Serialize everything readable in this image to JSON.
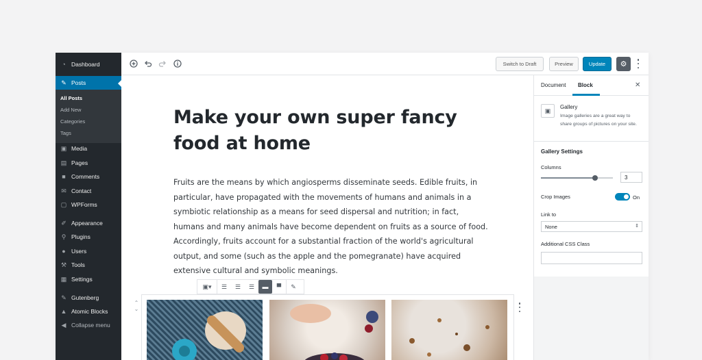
{
  "sidebar": {
    "items": [
      {
        "label": "Dashboard",
        "icon": "dashboard-icon"
      },
      {
        "label": "Posts",
        "icon": "pin-icon"
      },
      {
        "label": "Media",
        "icon": "media-icon"
      },
      {
        "label": "Pages",
        "icon": "pages-icon"
      },
      {
        "label": "Comments",
        "icon": "comment-icon"
      },
      {
        "label": "Contact",
        "icon": "mail-icon"
      },
      {
        "label": "WPForms",
        "icon": "forms-icon"
      },
      {
        "label": "Appearance",
        "icon": "brush-icon"
      },
      {
        "label": "Plugins",
        "icon": "plugin-icon"
      },
      {
        "label": "Users",
        "icon": "user-icon"
      },
      {
        "label": "Tools",
        "icon": "wrench-icon"
      },
      {
        "label": "Settings",
        "icon": "settings-icon"
      },
      {
        "label": "Gutenberg",
        "icon": "pencil-icon"
      },
      {
        "label": "Atomic Blocks",
        "icon": "blocks-icon"
      },
      {
        "label": "Collapse menu",
        "icon": "collapse-icon"
      }
    ],
    "sub_items": [
      "All Posts",
      "Add New",
      "Categories",
      "Tags"
    ]
  },
  "toolbar": {
    "switch_to_draft": "Switch to Draft",
    "preview": "Preview",
    "update": "Update"
  },
  "editor": {
    "title": "Make your own super fancy food at home",
    "paragraph": "Fruits are the means by which angiosperms disseminate seeds. Edible fruits, in particular, have propagated with the movements of humans and animals in a symbiotic relationship as a means for seed dispersal and nutrition; in fact, humans and many animals have become dependent on fruits as a source of food. Accordingly, fruits account for a substantial fraction of the world's agricultural output, and some (such as the apple and the pomegranate) have acquired extensive cultural and symbolic meanings."
  },
  "panel": {
    "tabs": [
      "Document",
      "Block"
    ],
    "block_name": "Gallery",
    "block_description": "Image galleries are a great way to share groups of pictures on your site.",
    "section_title": "Gallery Settings",
    "columns_label": "Columns",
    "columns_value": "3",
    "columns_fraction": 0.75,
    "crop_label": "Crop Images",
    "crop_state": "On",
    "link_label": "Link to",
    "link_value": "None",
    "css_label": "Additional CSS Class",
    "css_value": ""
  },
  "colors": {
    "sidebar_bg": "#23282d",
    "accent": "#0073aa",
    "primary_button": "#0085ba"
  }
}
